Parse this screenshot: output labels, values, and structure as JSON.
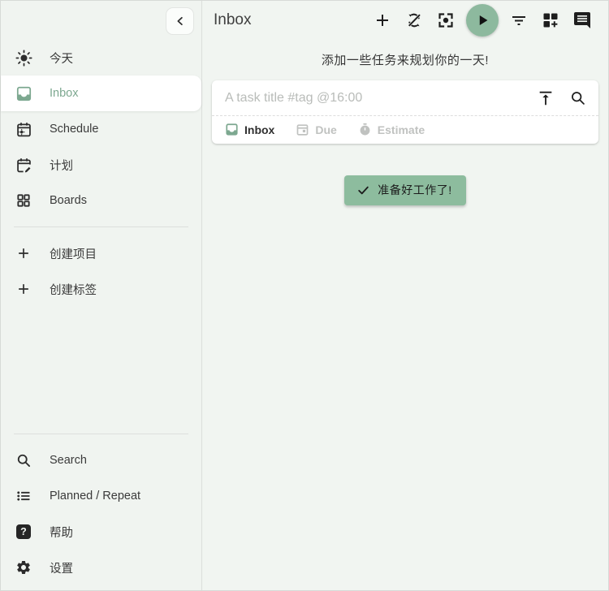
{
  "colors": {
    "accent_green": "#8dbc9e",
    "selected_text_green": "#7da890",
    "background": "#f0f4f0"
  },
  "sidebar": {
    "collapse_tooltip_icon": "chevron-left-icon",
    "items": [
      {
        "label": "今天",
        "icon": "sun-icon",
        "selected": false
      },
      {
        "label": "Inbox",
        "icon": "inbox-icon",
        "selected": true
      },
      {
        "label": "Schedule",
        "icon": "calendar-sun-icon",
        "selected": false
      },
      {
        "label": "计划",
        "icon": "calendar-edit-icon",
        "selected": false
      },
      {
        "label": "Boards",
        "icon": "grid-icon",
        "selected": false
      }
    ],
    "create_items": [
      {
        "label": "创建项目",
        "icon": "plus-icon"
      },
      {
        "label": "创建标签",
        "icon": "plus-icon"
      }
    ],
    "bottom_items": [
      {
        "label": "Search",
        "icon": "search-icon"
      },
      {
        "label": "Planned / Repeat",
        "icon": "list-icon"
      },
      {
        "label": "帮助",
        "icon": "help-icon"
      },
      {
        "label": "设置",
        "icon": "gear-icon"
      }
    ],
    "help_glyph": "?"
  },
  "header": {
    "title": "Inbox",
    "toolbar_icons": [
      "add-icon",
      "sync-disabled-icon",
      "focus-mode-icon",
      "play-icon",
      "filter-icon",
      "dashboard-add-icon",
      "feedback-icon"
    ]
  },
  "main": {
    "heading": "添加一些任务来规划你的一天!",
    "add_task": {
      "placeholder": "A task title #tag @16:00",
      "icons": [
        "vertical-align-top-icon",
        "search-icon"
      ],
      "chips": [
        {
          "label": "Inbox",
          "icon": "inbox-icon",
          "state": "active"
        },
        {
          "label": "Due",
          "icon": "calendar-icon",
          "state": "muted"
        },
        {
          "label": "Estimate",
          "icon": "timer-icon",
          "state": "muted"
        }
      ]
    },
    "ready_button_label": "准备好工作了!"
  }
}
